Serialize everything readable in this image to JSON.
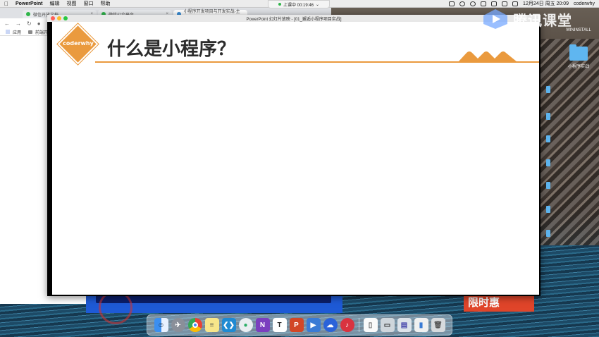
{
  "menubar": {
    "apple": "",
    "app": "PowerPoint",
    "menus": [
      "编辑",
      "视图",
      "窗口",
      "帮助"
    ],
    "datetime": "12月24日 周五 20:09",
    "user": "coderwhy"
  },
  "browser": {
    "tabs": [
      "微信开放文档",
      "微信公众平台",
      "小程序开发项目与开发实战-主课…"
    ],
    "bookmarks": [
      "应用",
      "前端开发"
    ]
  },
  "timer": {
    "label": "上课中 00:19:46"
  },
  "watermark": {
    "text": "腾讯课堂"
  },
  "desktop": {
    "items": [
      "WININSTALL",
      "小程序实战"
    ]
  },
  "ppt": {
    "window_title": "PowerPoint 幻灯片放映 - [01_邂逅小程序项目实战]",
    "badge_text": "coderwhy",
    "slide_title": "什么是小程序？",
    "accent_color": "#ea9a3e"
  },
  "promo": {
    "text": "限时惠"
  },
  "dock": {
    "apps": [
      "finder-icon",
      "launchpad-icon",
      "chrome-icon",
      "notes-icon",
      "vscode-icon",
      "wechat-icon",
      "onenote-icon",
      "typora-icon",
      "powerpoint-icon",
      "tencent-class-icon",
      "baidu-netdisk-icon",
      "netease-music-icon",
      "document-icon",
      "screenshot-icon",
      "pdf-icon",
      "file-icon",
      "trash-icon"
    ]
  }
}
